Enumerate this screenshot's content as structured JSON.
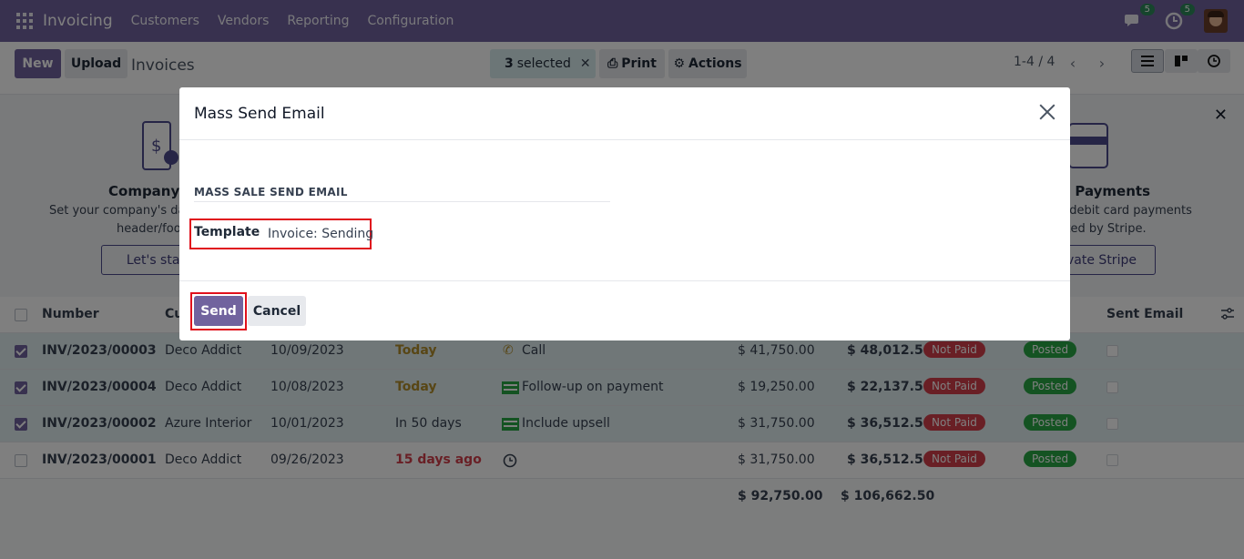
{
  "navbar": {
    "app_name": "Invoicing",
    "menu": [
      "Customers",
      "Vendors",
      "Reporting",
      "Configuration"
    ],
    "messages_count": "5",
    "activities_count": "5"
  },
  "control": {
    "new_label": "New",
    "upload_label": "Upload",
    "title": "Invoices",
    "selected_count": "3",
    "selected_text": "selected",
    "print_label": "Print",
    "actions_label": "Actions",
    "pager": "1-4 / 4"
  },
  "banner": {
    "left_title": "Company D",
    "left_text_1": "Set your company's data",
    "left_text_2": "header/foot",
    "left_button": "Let's star",
    "right_title": "e Payments",
    "right_text_1": "& debit card payments",
    "right_text_2": "rted by Stripe.",
    "right_button": "vate Stripe"
  },
  "list": {
    "headers": {
      "number": "Number",
      "customer": "Cu",
      "sent_email": "Sent Email"
    },
    "rows": [
      {
        "number": "INV/2023/00003",
        "customer": "Deco Addict",
        "date": "10/09/2023",
        "due": "Today",
        "activity": "Call",
        "untaxed": "$ 41,750.00",
        "total": "$ 48,012.50",
        "payment": "Not Paid",
        "status": "Posted"
      },
      {
        "number": "INV/2023/00004",
        "customer": "Deco Addict",
        "date": "10/08/2023",
        "due": "Today",
        "activity": "Follow-up on payment",
        "untaxed": "$ 19,250.00",
        "total": "$ 22,137.50",
        "payment": "Not Paid",
        "status": "Posted"
      },
      {
        "number": "INV/2023/00002",
        "customer": "Azure Interior",
        "date": "10/01/2023",
        "due": "In 50 days",
        "activity": "Include upsell",
        "untaxed": "$ 31,750.00",
        "total": "$ 36,512.50",
        "payment": "Not Paid",
        "status": "Posted"
      },
      {
        "number": "INV/2023/00001",
        "customer": "Deco Addict",
        "date": "09/26/2023",
        "due": "15 days ago",
        "activity": "",
        "untaxed": "$ 31,750.00",
        "total": "$ 36,512.50",
        "payment": "Not Paid",
        "status": "Posted"
      }
    ],
    "totals": {
      "untaxed": "$ 92,750.00",
      "total": "$ 106,662.50"
    }
  },
  "modal": {
    "title": "Mass Send Email",
    "section_title": "MASS SALE SEND EMAIL",
    "template_label": "Template",
    "template_value": "Invoice: Sending",
    "send_label": "Send",
    "cancel_label": "Cancel"
  },
  "colors": {
    "brand": "#71639e",
    "highlight": "#e0101c",
    "not_paid": "#d23f4b",
    "posted": "#28a745",
    "selected_row": "#e1eff1"
  }
}
